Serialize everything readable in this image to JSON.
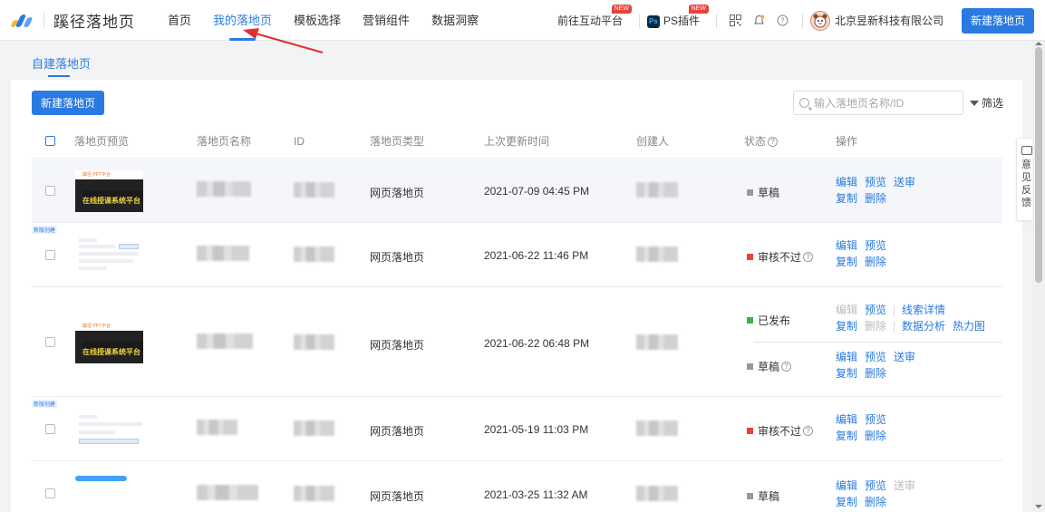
{
  "header": {
    "brand": "蹊径落地页",
    "nav": [
      "首页",
      "我的落地页",
      "模板选择",
      "营销组件",
      "数据洞察"
    ],
    "nav_active": 1,
    "interactive_platform": "前往互动平台",
    "ps_plugin": "PS插件",
    "new_badge": "NEW",
    "ps_icon_text": "Ps",
    "company": "北京昱新科技有限公司",
    "create_btn": "新建落地页"
  },
  "subtab": "自建落地页",
  "toolbar": {
    "create_btn": "新建落地页",
    "search_placeholder": "输入落地页名称/ID",
    "filter_label": "筛选"
  },
  "table": {
    "columns": [
      "落地页预览",
      "落地页名称",
      "ID",
      "落地页类型",
      "上次更新时间",
      "创建人",
      "状态",
      "操作"
    ],
    "rows": [
      {
        "type": "网页落地页",
        "updated": "2021-07-09 04:45 PM",
        "status": "草稿",
        "status_color": "#999999",
        "status_help": false,
        "ops": [
          [
            "编辑",
            "预览",
            "送审"
          ],
          [
            "复制",
            "删除"
          ]
        ],
        "thumb": "dark"
      },
      {
        "type": "网页落地页",
        "updated": "2021-06-22 11:46 PM",
        "status": "审核不过",
        "status_color": "#e8423a",
        "status_help": true,
        "ops": [
          [
            "编辑",
            "预览"
          ],
          [
            "复制",
            "删除"
          ]
        ],
        "thumb": "form",
        "tag": "新版创建"
      },
      {
        "type": "网页落地页",
        "updated": "2021-06-22 06:48 PM",
        "thumb": "dark",
        "sub": [
          {
            "status": "已发布",
            "status_color": "#3bb24a",
            "status_help": false,
            "ops_line1": [
              "编辑",
              "预览"
            ],
            "ops_line1_extra": "线索详情",
            "ops_line2": [
              "复制",
              "删除"
            ],
            "ops_line2_extra": [
              "数据分析",
              "热力图"
            ]
          },
          {
            "status": "草稿",
            "status_color": "#999999",
            "status_help": true,
            "ops_line1": [
              "编辑",
              "预览",
              "送审"
            ],
            "ops_line2": [
              "复制",
              "删除"
            ]
          }
        ]
      },
      {
        "type": "网页落地页",
        "updated": "2021-05-19 11:03 PM",
        "status": "审核不过",
        "status_color": "#e8423a",
        "status_help": true,
        "ops": [
          [
            "编辑",
            "预览"
          ],
          [
            "复制",
            "删除"
          ]
        ],
        "thumb": "form",
        "tag": "新版创建"
      },
      {
        "type": "网页落地页",
        "updated": "2021-03-25 11:32 AM",
        "status": "草稿",
        "status_color": "#999999",
        "status_help": false,
        "ops": [
          [
            "编辑",
            "预览",
            "送审"
          ],
          [
            "复制",
            "删除"
          ]
        ],
        "thumb": "pill"
      }
    ]
  },
  "thumb_texts": {
    "dark_top": "蹊径 PPT平台",
    "dark_main": "在线授课系统平台"
  },
  "feedback": "意见反馈",
  "colors": {
    "primary": "#2a7ae2",
    "red": "#e8423a",
    "green": "#3bb24a",
    "annotation": "#e0302e"
  }
}
